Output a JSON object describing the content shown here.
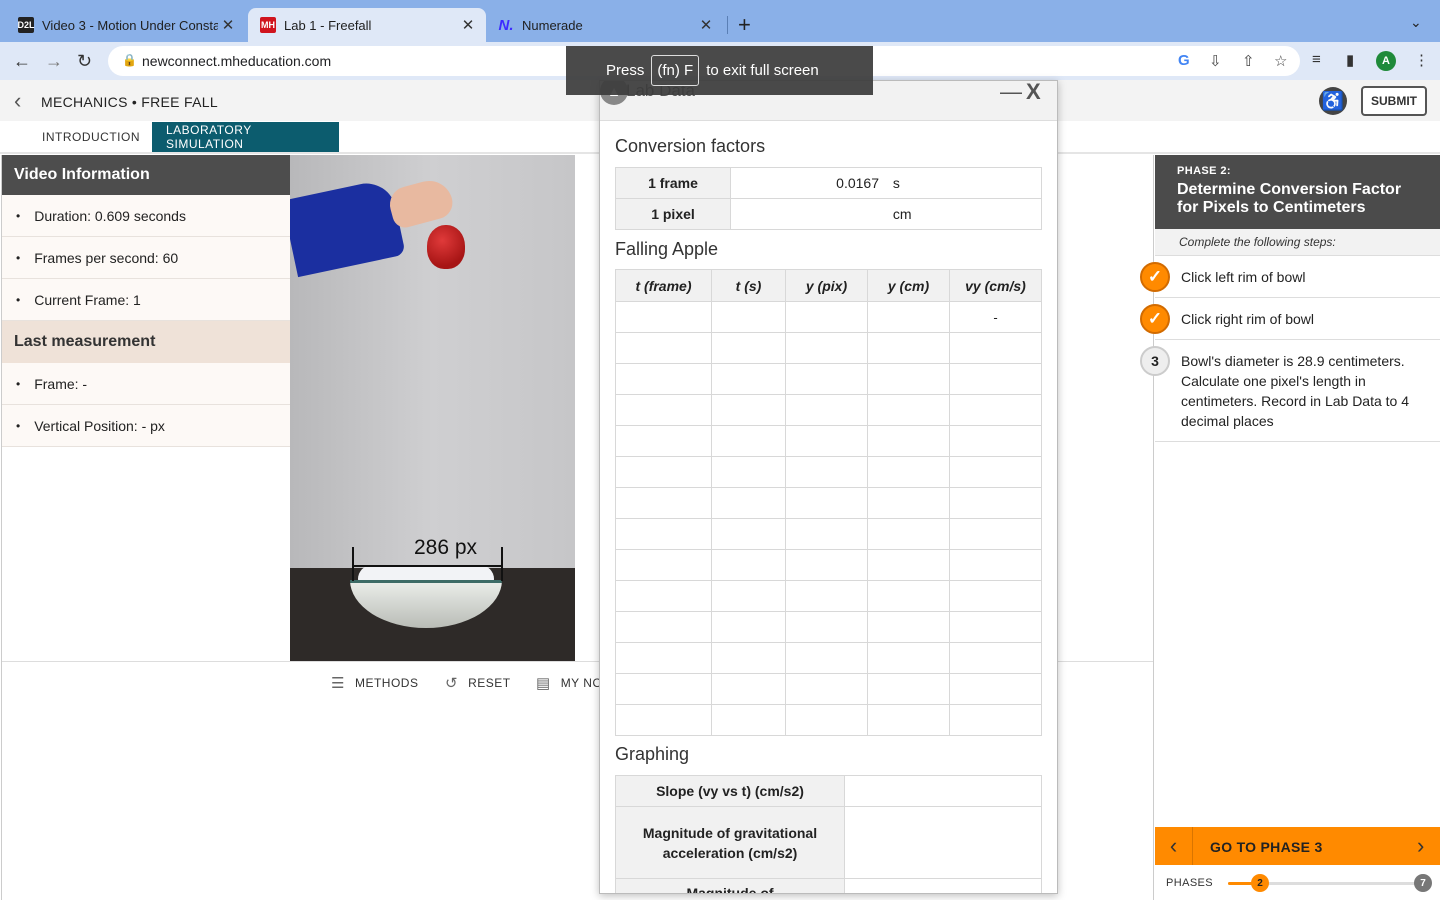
{
  "browser": {
    "tabs": [
      {
        "title": "Video 3 - Motion Under Consta",
        "favicon": "D2L"
      },
      {
        "title": "Lab 1 - Freefall",
        "favicon": "MH"
      },
      {
        "title": "Numerade",
        "favicon": "N."
      }
    ],
    "url": "newconnect.mheducation.com",
    "profile_initial": "A",
    "fullscreen_toast": {
      "pre": "Press",
      "key": "(fn) F",
      "post": "to exit full screen"
    }
  },
  "app": {
    "breadcrumb": "MECHANICS • FREE FALL",
    "submit_label": "SUBMIT",
    "tabs": [
      "INTRODUCTION",
      "LABORATORY SIMULATION"
    ]
  },
  "video_info": {
    "heading": "Video Information",
    "items": [
      "Duration: 0.609 seconds",
      "Frames per second: 60",
      "Current Frame: 1"
    ],
    "last_heading": "Last measurement",
    "last_items": [
      "Frame: -",
      "Vertical Position: - px"
    ]
  },
  "video": {
    "measure_label": "286 px"
  },
  "bottom_bar": {
    "methods": "METHODS",
    "reset": "RESET",
    "notes": "MY NO"
  },
  "lab_data": {
    "title": "Lab Data",
    "conversion_title": "Conversion factors",
    "conversion": [
      {
        "label": "1 frame",
        "value": "0.0167",
        "unit": "s"
      },
      {
        "label": "1 pixel",
        "value": "",
        "unit": "cm"
      }
    ],
    "apple_title": "Falling Apple",
    "apple_headers": [
      "t (frame)",
      "t (s)",
      "y (pix)",
      "y (cm)",
      "vy (cm/s)"
    ],
    "first_row_vy": "-",
    "graphing_title": "Graphing",
    "graphing_rows": [
      "Slope (vy vs t) (cm/s2)",
      "Magnitude of gravitational acceleration (cm/s2)",
      "Magnitude of"
    ]
  },
  "phase": {
    "label": "PHASE 2:",
    "title": "Determine Conversion Factor for Pixels to Centimeters",
    "hint": "Complete the following steps:",
    "steps": [
      {
        "text": "Click left rim of bowl",
        "done": true
      },
      {
        "text": "Click right rim of bowl",
        "done": true
      },
      {
        "num": "3",
        "text": "Bowl's diameter is 28.9 centimeters. Calculate one pixel's length in centimeters. Record in Lab Data to 4 decimal places",
        "done": false
      }
    ],
    "go_label": "GO TO PHASE 3",
    "phases_label": "PHASES",
    "current_phase": "2",
    "last_phase": "7",
    "progress_fraction": 0.17
  },
  "colors": {
    "accent": "#ff8a00",
    "teal": "#0c5c6e",
    "dark_header": "#4b4b4b"
  }
}
